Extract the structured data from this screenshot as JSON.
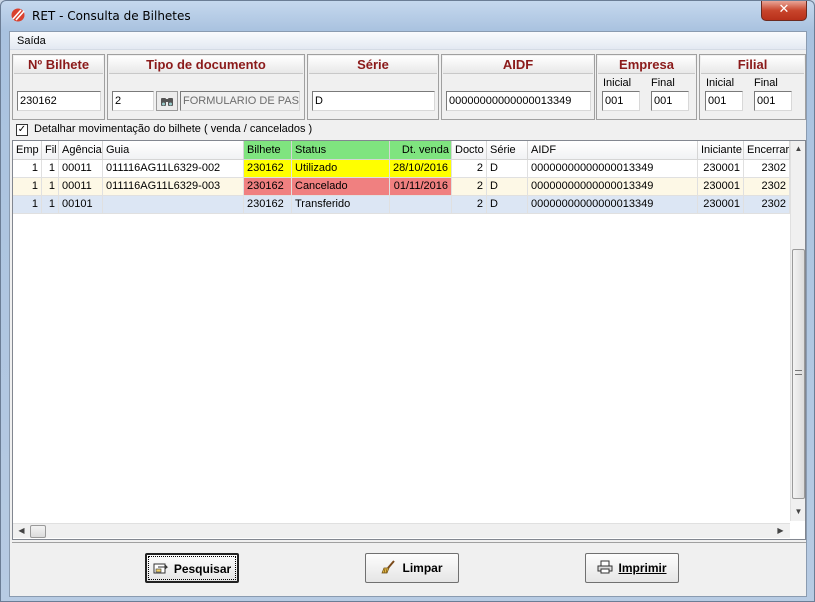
{
  "window": {
    "title": "RET - Consulta de Bilhetes",
    "close_label": "✕"
  },
  "menu": {
    "items": [
      "Saída"
    ]
  },
  "filters": {
    "bilhete": {
      "header": "Nº Bilhete",
      "value": "230162"
    },
    "tipo_documento": {
      "header": "Tipo de documento",
      "code": "2",
      "description": "FORMULARIO DE PAS",
      "lookup_icon": "binoculars-icon"
    },
    "serie": {
      "header": "Série",
      "value": "D"
    },
    "aidf": {
      "header": "AIDF",
      "value": "00000000000000013349"
    },
    "empresa": {
      "header": "Empresa",
      "inicial_label": "Inicial",
      "final_label": "Final",
      "inicial": "001",
      "final": "001"
    },
    "filial": {
      "header": "Filial",
      "inicial_label": "Inicial",
      "final_label": "Final",
      "inicial": "001",
      "final": "001"
    }
  },
  "detalhar": {
    "checked": true,
    "check_mark": "✓",
    "label": "Detalhar movimentação do bilhete ( venda / cancelados )"
  },
  "grid": {
    "columns": [
      "Emp",
      "Fil",
      "Agência",
      "Guia",
      "Bilhete",
      "Status",
      "Dt. venda",
      "Docto",
      "Série",
      "AIDF",
      "Iniciante",
      "Encerrar"
    ],
    "rows": [
      {
        "emp": "1",
        "fil": "1",
        "agencia": "00011",
        "guia": "011116AG11L6329-002",
        "bilhete": "230162",
        "status": "Utilizado",
        "dt_venda": "28/10/2016",
        "docto": "2",
        "serie": "D",
        "aidf": "00000000000000013349",
        "iniciante": "230001",
        "encerrar": "2302"
      },
      {
        "emp": "1",
        "fil": "1",
        "agencia": "00011",
        "guia": "011116AG11L6329-003",
        "bilhete": "230162",
        "status": "Cancelado",
        "dt_venda": "01/11/2016",
        "docto": "2",
        "serie": "D",
        "aidf": "00000000000000013349",
        "iniciante": "230001",
        "encerrar": "2302"
      },
      {
        "emp": "1",
        "fil": "1",
        "agencia": "00101",
        "guia": "",
        "bilhete": "230162",
        "status": "Transferido",
        "dt_venda": "",
        "docto": "2",
        "serie": "D",
        "aidf": "00000000000000013349",
        "iniciante": "230001",
        "encerrar": "2302"
      }
    ],
    "colors": {
      "header_highlight": "#7fe47f",
      "utilizado": "#ffff00",
      "cancelado": "#f08080",
      "row2_bg": "#fdf8e6",
      "row3_bg": "#dce6f4"
    }
  },
  "buttons": {
    "pesquisar": {
      "label": "Pesquisar",
      "icon": "search-hand-icon"
    },
    "limpar": {
      "label": "Limpar",
      "icon": "broom-icon"
    },
    "imprimir": {
      "label": "Imprimir",
      "icon": "printer-icon"
    }
  }
}
